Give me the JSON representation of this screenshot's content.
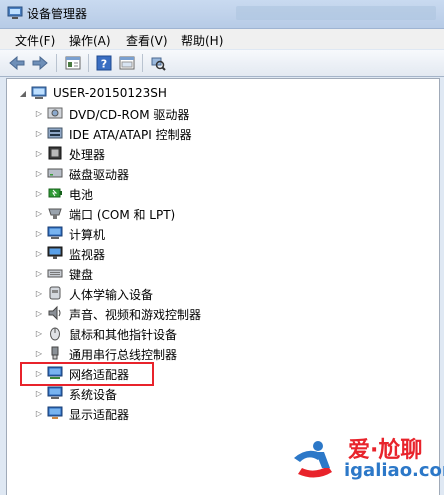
{
  "window": {
    "title": "设备管理器"
  },
  "menu": [
    {
      "label": "文件(F)"
    },
    {
      "label": "操作(A)"
    },
    {
      "label": "查看(V)"
    },
    {
      "label": "帮助(H)"
    }
  ],
  "toolbar": {
    "icons": [
      "back-icon",
      "forward-icon",
      "properties-icon",
      "help-icon",
      "show-hide-icon",
      "scan-hardware-icon"
    ]
  },
  "tree": {
    "root": "USER-20150123SH",
    "items": [
      {
        "label": "DVD/CD-ROM 驱动器",
        "icon": "disc-drive-icon"
      },
      {
        "label": "IDE ATA/ATAPI 控制器",
        "icon": "ide-controller-icon"
      },
      {
        "label": "处理器",
        "icon": "processor-icon"
      },
      {
        "label": "磁盘驱动器",
        "icon": "disk-drive-icon"
      },
      {
        "label": "电池",
        "icon": "battery-icon"
      },
      {
        "label": "端口 (COM 和 LPT)",
        "icon": "port-icon"
      },
      {
        "label": "计算机",
        "icon": "computer-icon"
      },
      {
        "label": "监视器",
        "icon": "monitor-icon"
      },
      {
        "label": "键盘",
        "icon": "keyboard-icon"
      },
      {
        "label": "人体学输入设备",
        "icon": "hid-icon"
      },
      {
        "label": "声音、视频和游戏控制器",
        "icon": "sound-icon"
      },
      {
        "label": "鼠标和其他指针设备",
        "icon": "mouse-icon"
      },
      {
        "label": "通用串行总线控制器",
        "icon": "usb-icon"
      },
      {
        "label": "网络适配器",
        "icon": "network-adapter-icon"
      },
      {
        "label": "系统设备",
        "icon": "system-device-icon"
      },
      {
        "label": "显示适配器",
        "icon": "display-adapter-icon"
      }
    ]
  },
  "watermark": {
    "main": "爱·尬聊",
    "sub": "igaliao.com"
  },
  "colors": {
    "highlight": "#e8232b",
    "watermark_red": "#e8232b",
    "watermark_blue": "#2c78c8"
  }
}
